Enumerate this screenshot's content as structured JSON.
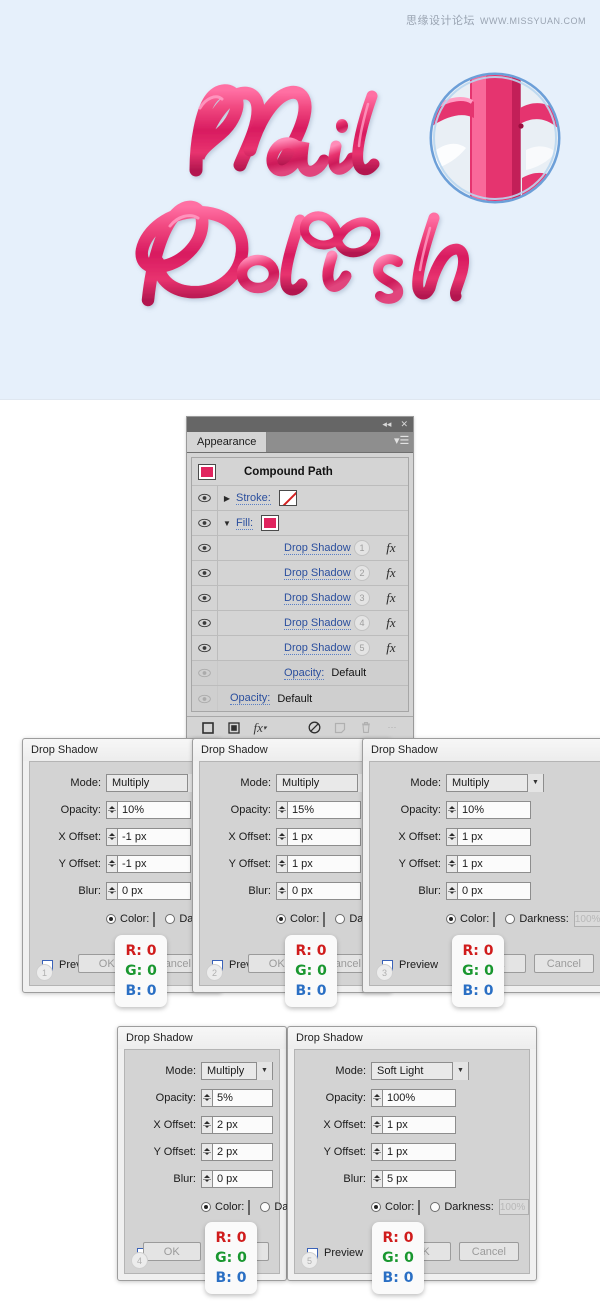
{
  "artwork": {
    "watermark_cn": "思缘设计论坛",
    "watermark_url": "WWW.MISSYUAN.COM",
    "word_top": "Nail",
    "word_bottom": "Polish",
    "background_color": "#e6f0fb",
    "text_color": "#e0245e",
    "magnifier_border_color": "#6c9fd8"
  },
  "appearance_panel": {
    "tab_label": "Appearance",
    "collapse_icon": "collapse-double-arrow-icon",
    "close_icon": "close-icon",
    "menu_icon": "panel-menu-icon",
    "object_title": "Compound Path",
    "fill_swatch_color": "#e0245e",
    "rows": [
      {
        "label": "Stroke:",
        "type": "stroke",
        "swatch": "none",
        "expanded": false
      },
      {
        "label": "Fill:",
        "type": "fill",
        "swatch": "#e0245e",
        "expanded": true
      }
    ],
    "effects": [
      {
        "label": "Drop Shadow",
        "number": "1",
        "fx": "fx"
      },
      {
        "label": "Drop Shadow",
        "number": "2",
        "fx": "fx"
      },
      {
        "label": "Drop Shadow",
        "number": "3",
        "fx": "fx"
      },
      {
        "label": "Drop Shadow",
        "number": "4",
        "fx": "fx"
      },
      {
        "label": "Drop Shadow",
        "number": "5",
        "fx": "fx"
      }
    ],
    "opacity_rows": [
      {
        "label": "Opacity:",
        "value": "Default",
        "indent": "deep"
      },
      {
        "label": "Opacity:",
        "value": "Default",
        "indent": "shallow"
      }
    ],
    "footer_icons": [
      "new-stroke-icon",
      "new-fill-icon",
      "add-effect-fx-icon",
      "clear-appearance-icon",
      "duplicate-item-icon",
      "delete-item-icon"
    ]
  },
  "dialog_labels": {
    "title": "Drop Shadow",
    "mode": "Mode:",
    "opacity": "Opacity:",
    "x_offset": "X Offset:",
    "y_offset": "Y Offset:",
    "blur": "Blur:",
    "color": "Color:",
    "darkness": "Darkness:",
    "darkness_value": "100%",
    "preview": "Preview",
    "cancel": "Cancel",
    "ok": "OK"
  },
  "rgb_tooltip": {
    "r": "R: 0",
    "g": "G: 0",
    "b": "B: 0"
  },
  "dialogs": [
    {
      "number": "1",
      "mode": "Multiply",
      "opacity": "10%",
      "x_offset": "-1 px",
      "y_offset": "-1 px",
      "blur": "0 px"
    },
    {
      "number": "2",
      "mode": "Multiply",
      "opacity": "15%",
      "x_offset": "1 px",
      "y_offset": "1 px",
      "blur": "0 px"
    },
    {
      "number": "3",
      "mode": "Multiply",
      "opacity": "10%",
      "x_offset": "1 px",
      "y_offset": "1 px",
      "blur": "0 px"
    },
    {
      "number": "4",
      "mode": "Multiply",
      "opacity": "5%",
      "x_offset": "2 px",
      "y_offset": "2 px",
      "blur": "0 px"
    },
    {
      "number": "5",
      "mode": "Soft Light",
      "opacity": "100%",
      "x_offset": "1 px",
      "y_offset": "1 px",
      "blur": "5 px"
    }
  ]
}
